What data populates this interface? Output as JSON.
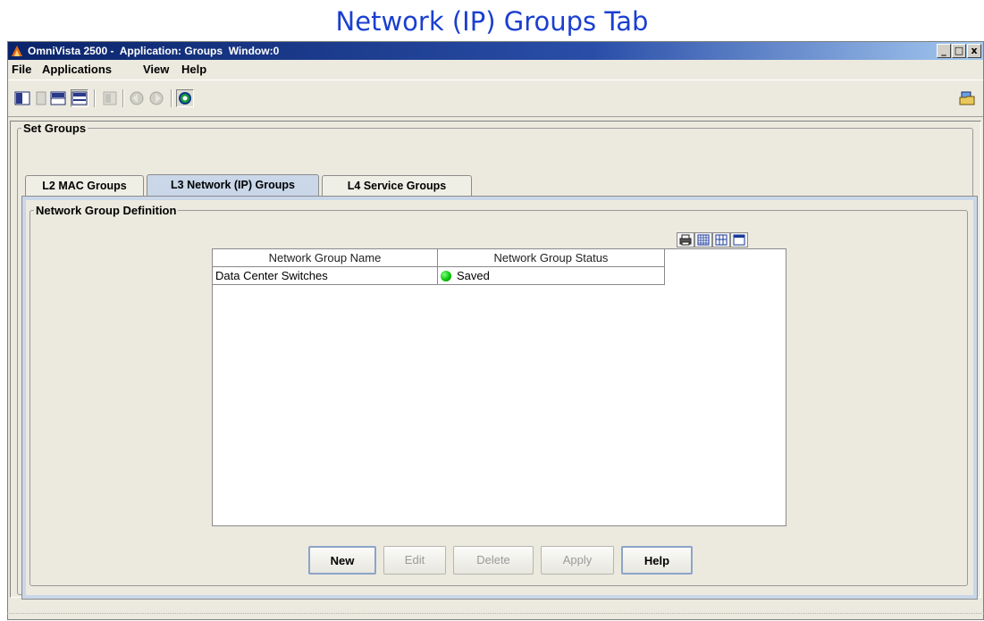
{
  "slide": {
    "title": "Network (IP) Groups Tab"
  },
  "window": {
    "title": "OmniVista 2500 -  Application: Groups  Window:0",
    "controls": [
      "_",
      "□",
      "x"
    ]
  },
  "menu": [
    "File",
    "Applications",
    "View",
    "Help"
  ],
  "toolbar": {
    "icons": [
      "split-vertical-icon",
      "panel-icon",
      "split-horizontal-icon",
      "split-horizontal-alt-icon",
      "disabled-panel-icon",
      "back-arrow-icon",
      "forward-arrow-icon",
      "refresh-icon"
    ],
    "right_icon": "open-folder-icon"
  },
  "set_groups": {
    "legend": "Set Groups"
  },
  "tabs": [
    {
      "label": "L2 MAC Groups",
      "active": false
    },
    {
      "label": "L3 Network (IP) Groups",
      "active": true
    },
    {
      "label": "L4 Service Groups",
      "active": false
    }
  ],
  "definition": {
    "legend": "Network Group Definition"
  },
  "table": {
    "tool_icons": [
      "print-icon",
      "grid-icon",
      "columns-icon",
      "table-icon"
    ],
    "columns": [
      "Network Group Name",
      "Network Group Status"
    ],
    "rows": [
      {
        "name": "Data Center Switches",
        "status": "Saved",
        "status_color": "#00c000"
      }
    ]
  },
  "buttons": [
    {
      "label": "New",
      "enabled": true
    },
    {
      "label": "Edit",
      "enabled": false
    },
    {
      "label": "Delete",
      "enabled": false
    },
    {
      "label": "Apply",
      "enabled": false
    },
    {
      "label": "Help",
      "enabled": true
    }
  ]
}
